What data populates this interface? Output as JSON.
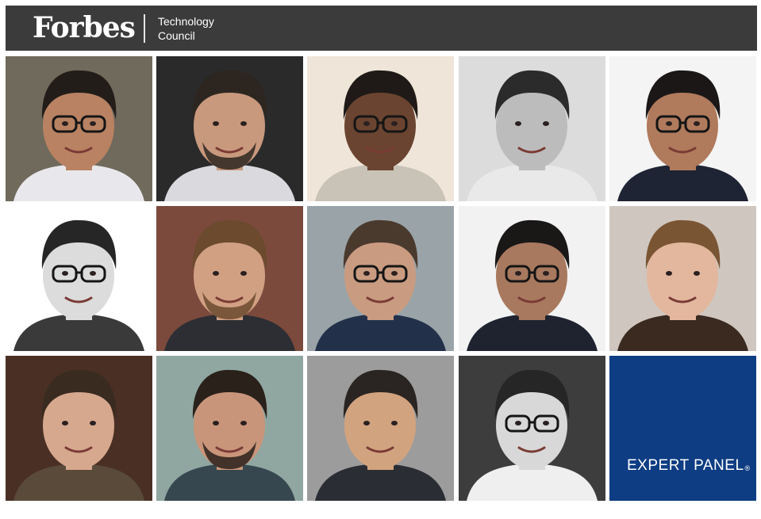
{
  "header": {
    "logo_text": "Forbes",
    "council_line1": "Technology",
    "council_line2": "Council"
  },
  "panel": {
    "label": "EXPERT PANEL",
    "mark": "®",
    "color": "#0e3d83"
  },
  "portraits": [
    {
      "bg": "#6f6a5c",
      "skin": "#b98262",
      "hair": "#231d1a",
      "shirt": "#e8e8ec",
      "glasses": true,
      "beard": false
    },
    {
      "bg": "#2a2a2a",
      "skin": "#c9997d",
      "hair": "#2d2620",
      "shirt": "#d9d9de",
      "glasses": false,
      "beard": true
    },
    {
      "bg": "#efe6d9",
      "skin": "#6a4430",
      "hair": "#1f1a17",
      "shirt": "#c9c2b6",
      "glasses": true,
      "beard": false
    },
    {
      "bg": "#dcdcdc",
      "skin": "#bcbcbc",
      "hair": "#2b2b2b",
      "shirt": "#e9e9e9",
      "glasses": false,
      "beard": false
    },
    {
      "bg": "#f4f4f4",
      "skin": "#b07a5c",
      "hair": "#1b1717",
      "shirt": "#1e2433",
      "glasses": true,
      "beard": false
    },
    {
      "bg": "#ffffff",
      "skin": "#dcdcdc",
      "hair": "#262626",
      "shirt": "#3a3a3a",
      "glasses": true,
      "beard": false
    },
    {
      "bg": "#7b4a3c",
      "skin": "#d1a083",
      "hair": "#6b4a2e",
      "shirt": "#2c2e33",
      "glasses": false,
      "beard": true
    },
    {
      "bg": "#9aa4a8",
      "skin": "#c99b80",
      "hair": "#4a3a2e",
      "shirt": "#22304a",
      "glasses": true,
      "beard": false
    },
    {
      "bg": "#f2f2f2",
      "skin": "#a8795e",
      "hair": "#1a1717",
      "shirt": "#1f2330",
      "glasses": true,
      "beard": false
    },
    {
      "bg": "#cfc7bf",
      "skin": "#e3b79e",
      "hair": "#7a5534",
      "shirt": "#3a2a20",
      "glasses": false,
      "beard": false
    },
    {
      "bg": "#4a3024",
      "skin": "#d6a88e",
      "hair": "#3a2b20",
      "shirt": "#5a4a3a",
      "glasses": false,
      "beard": false
    },
    {
      "bg": "#8fa7a0",
      "skin": "#c9957a",
      "hair": "#2a211b",
      "shirt": "#37474f",
      "glasses": false,
      "beard": true
    },
    {
      "bg": "#9c9c9c",
      "skin": "#d2a37f",
      "hair": "#2a2522",
      "shirt": "#2a2d33",
      "glasses": false,
      "beard": false
    },
    {
      "bg": "#3d3d3d",
      "skin": "#d8d8d8",
      "hair": "#262626",
      "shirt": "#efefef",
      "glasses": true,
      "beard": false
    }
  ]
}
